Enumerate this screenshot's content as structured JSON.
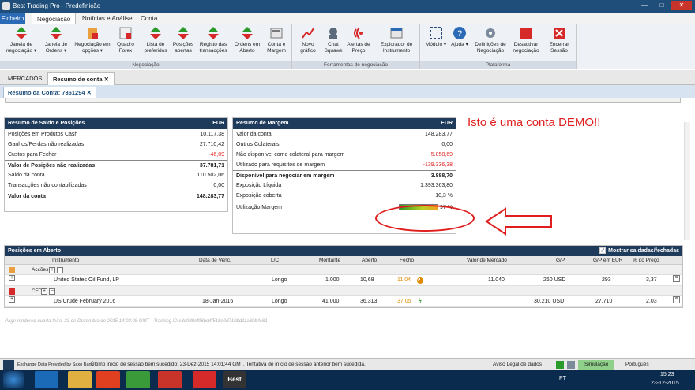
{
  "window": {
    "title": "Best Trading Pro - Predefinição",
    "minimize": "—",
    "maximize": "□",
    "close": "✕"
  },
  "menu": {
    "file": "Ficheiro",
    "tabs": [
      "Negociação",
      "Notícias e Análise",
      "Conta"
    ]
  },
  "ribbon": {
    "groups": [
      {
        "label": "Negociação",
        "buttons": [
          "Janela de negociação ▾",
          "Janela de Ordens ▾",
          "Negociação em opções ▾",
          "Quadro Forex",
          "Lista de preferidos",
          "Posições abertas",
          "Registo das transacções",
          "Ordens em Aberto",
          "Conta e Margem"
        ]
      },
      {
        "label": "Ferramentas de negociação",
        "buttons": [
          "Novo gráfico",
          "Chat Squawk",
          "Alertas de Preço",
          "Explorador de Instrumento"
        ]
      },
      {
        "label": "Plataforma",
        "buttons": [
          "Módulo ▾",
          "Ajuda ▾",
          "Definições de Negociação",
          "Desactivar negociação",
          "Encerrar Sessão"
        ]
      }
    ]
  },
  "doctabs": {
    "markets": "MERCADOS",
    "account": "Resumo de conta",
    "close": "✕"
  },
  "subtab": {
    "label": "Resumo da Conta: 7361294",
    "close": "✕"
  },
  "demo_text": "Isto é uma conta DEMO!!",
  "balance_panel": {
    "title": "Resumo de Saldo e Posições",
    "currency": "EUR",
    "rows": [
      {
        "label": "Posições em Produtos Cash",
        "value": "10.117,38"
      },
      {
        "label": "Ganhos/Perdas não realizadas",
        "value": "27.710,42"
      },
      {
        "label": "Custos para Fechar",
        "value": "-46,09"
      },
      {
        "label": "Valor de Posições não realizadas",
        "value": "37.781,71"
      },
      {
        "label": "Saldo da conta",
        "value": "110.502,06"
      },
      {
        "label": "Transacções não contabilizadas",
        "value": "0,00"
      },
      {
        "label": "Valor da conta",
        "value": "148.283,77"
      }
    ]
  },
  "margin_panel": {
    "title": "Resumo de Margem",
    "currency": "EUR",
    "rows": [
      {
        "label": "Valor da conta",
        "value": "148.283,77"
      },
      {
        "label": "Outros Colaterais",
        "value": "0,00"
      },
      {
        "label": "Não disponível como colateral para margem",
        "value": "-5.058,69"
      },
      {
        "label": "Utilizado para requisitos de margem",
        "value": "-139.336,38"
      },
      {
        "label": "Disponível para negociar em margem",
        "value": "3.888,70"
      },
      {
        "label": "Exposição Líquida",
        "value": "1.393.363,80"
      },
      {
        "label": "Exposição coberta",
        "value": "10,3 %"
      }
    ],
    "utilization_label": "Utilização Margem",
    "utilization_value": "97 %",
    "utilization_fraction": 0.97
  },
  "positions": {
    "title": "Posições em Aberto",
    "show_settled": "Mostrar saldadas/fechadas",
    "columns": [
      "Instrumento",
      "Data de Venc.",
      "L/C",
      "Montante",
      "Aberto",
      "Fecho",
      "Valor de Mercado",
      "G/P",
      "G/P em EUR",
      "% do Preço"
    ],
    "groups": [
      {
        "name": "Acções",
        "rows": [
          {
            "instrument": "United States Oil Fund, LP",
            "expiry": "",
            "side": "Longo",
            "amount": "1.000",
            "open": "10,68",
            "close": "11,04",
            "market_value": "11.040",
            "pl": "260 USD",
            "pl_eur": "293",
            "pct": "3,37"
          }
        ]
      },
      {
        "name": "CFD",
        "rows": [
          {
            "instrument": "US Crude February 2016",
            "expiry": "18-Jan-2016",
            "side": "Longo",
            "amount": "41.000",
            "open": "36,313",
            "close": "37,05",
            "market_value": "30.210 USD",
            "pl": "",
            "pl_eur": "27.710",
            "pct": "2,03"
          }
        ]
      }
    ]
  },
  "footer": "Page rendered quarta-feira, 23 de Dezembro de 2015 14:03:08 GMT - Tracking ID c3e9d0ef96bd4f518e2d710bd11a30b4c81",
  "status": {
    "provider": "Exchange Data Provided by Saxo Bank",
    "session": "Último início de sessão bem sucedido: 23-Dez-2015 14:01:44 GMT. Tentativa de início de sessão anterior bem sucedida.",
    "legal": "Aviso Legal de dados",
    "mode": "Simulação",
    "language": "Português"
  },
  "taskbar": {
    "lang": "PT",
    "time": "15:23",
    "date": "23-12-2015",
    "best_label": "Best"
  }
}
